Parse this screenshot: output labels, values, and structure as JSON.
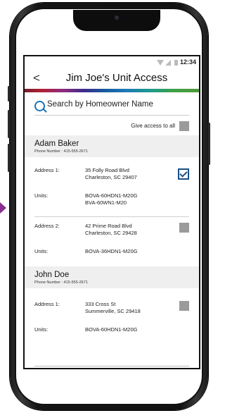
{
  "status_bar": {
    "time": "12:34"
  },
  "header": {
    "back_glyph": "<",
    "title": "Jim Joe's Unit Access"
  },
  "search": {
    "placeholder": "Search by Homeowner Name"
  },
  "give_access_all": {
    "label": "Give access to all",
    "checked": false
  },
  "homeowners": [
    {
      "name": "Adam Baker",
      "phone": "Phone Number : 415-555-2671",
      "addresses": [
        {
          "label": "Address 1:",
          "line1": "35 Folly Road Blvd",
          "line2": "Charleston, SC 29407",
          "checked": true,
          "units_label": "Units:",
          "units": [
            "BOVA-60HDN1-M20G",
            "BVA-60WN1-M20"
          ]
        },
        {
          "label": "Address 2:",
          "line1": "42 Prime Road Blvd",
          "line2": "Charleston, SC 29428",
          "checked": false,
          "units_label": "Units:",
          "units": [
            "BOVA-36HDN1-M20G"
          ]
        }
      ]
    },
    {
      "name": "John Doe",
      "phone": "Phone Number : 415-555-2671",
      "addresses": [
        {
          "label": "Address 1:",
          "line1": "333 Cross St",
          "line2": "Summerville, SC 29418",
          "checked": false,
          "units_label": "Units:",
          "units": [
            "BOVA-60HDN1-M20G"
          ]
        }
      ]
    }
  ]
}
